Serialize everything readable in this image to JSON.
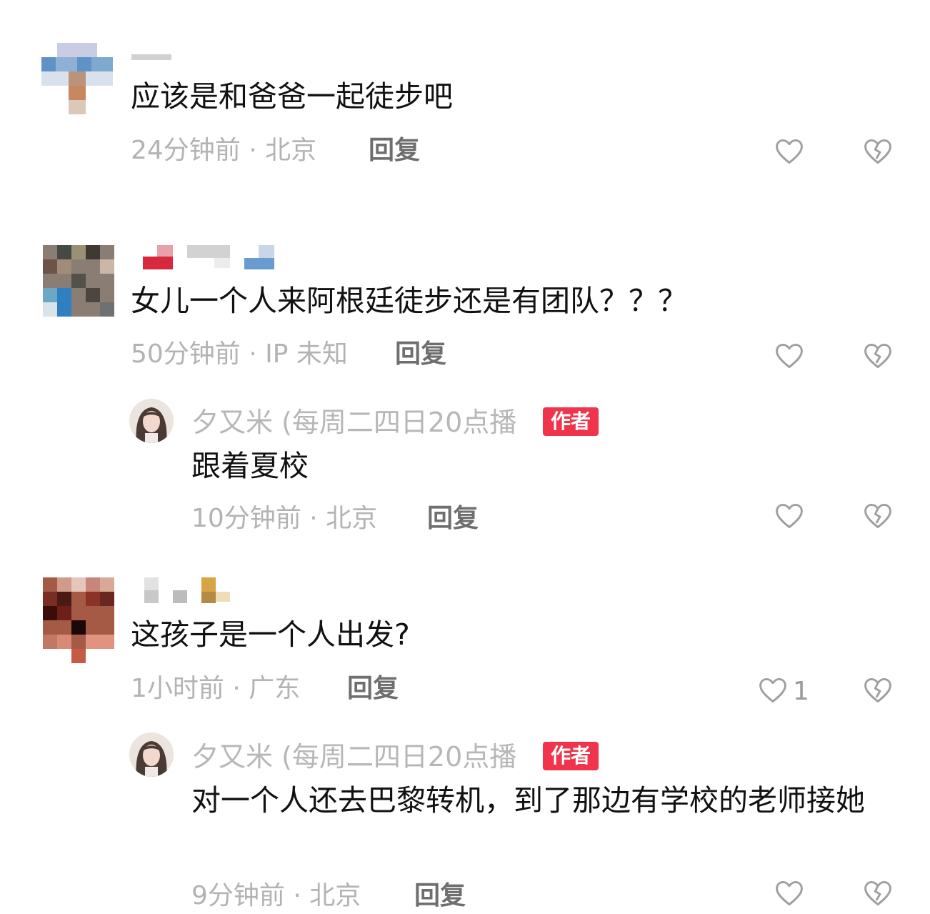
{
  "comments": [
    {
      "username": "",
      "text": "应该是和爸爸一起徒步吧",
      "meta": "24分钟前 · 北京",
      "reply_label": "回复",
      "like_count": "",
      "replies": []
    },
    {
      "username": "",
      "text": "女儿一个人来阿根廷徒步还是有团队？？？",
      "meta": "50分钟前 · IP 未知",
      "reply_label": "回复",
      "like_count": "",
      "replies": [
        {
          "username": "夕又米 (每周二四日20点播",
          "badge": "作者",
          "text": "跟着夏校",
          "meta": "10分钟前 · 北京",
          "reply_label": "回复",
          "like_count": ""
        }
      ]
    },
    {
      "username": "",
      "text": "这孩子是一个人出发?",
      "meta": "1小时前 · 广东",
      "reply_label": "回复",
      "like_count": "1",
      "replies": [
        {
          "username": "夕又米 (每周二四日20点播",
          "badge": "作者",
          "text": "对一个人还去巴黎转机，到了那边有学校的老师接她",
          "meta": "9分钟前 · 北京",
          "reply_label": "回复",
          "like_count": ""
        }
      ]
    }
  ],
  "icons": {
    "like": "heart-outline-icon",
    "dislike": "broken-heart-icon"
  },
  "colors": {
    "badge": "#f0344c",
    "meta_text": "#b3b3b3",
    "reply_text": "#6e6e6e"
  }
}
